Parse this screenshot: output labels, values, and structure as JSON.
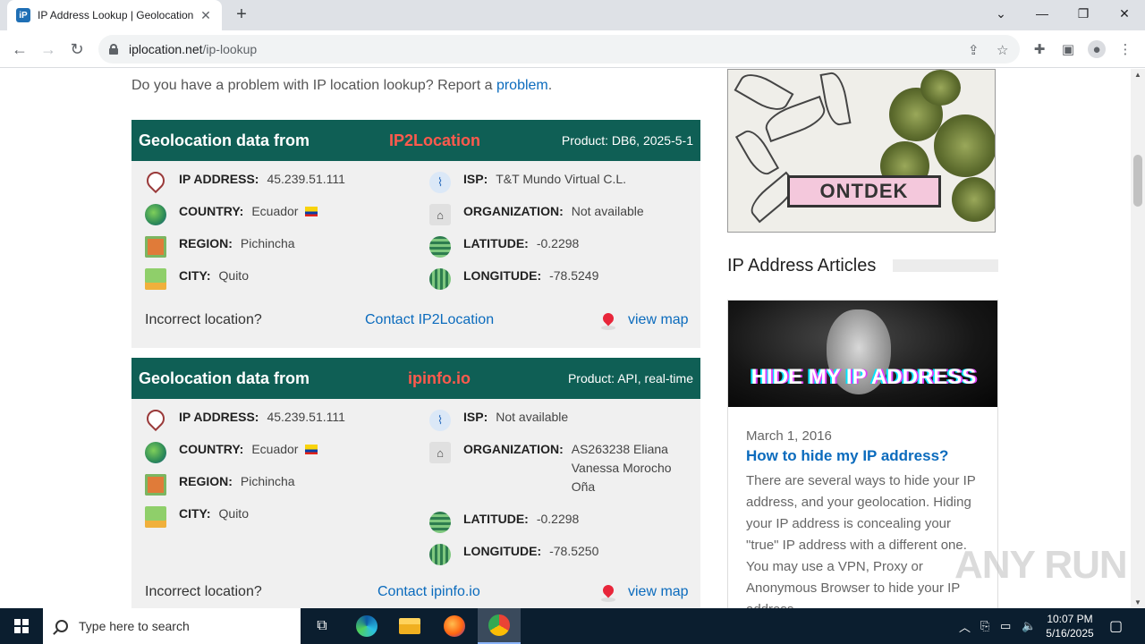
{
  "browser": {
    "tab_title": "IP Address Lookup | Geolocation",
    "favicon": "iP",
    "url_domain": "iplocation.net",
    "url_path": "/ip-lookup"
  },
  "page": {
    "report_text": "Do you have a problem with IP location lookup? Report a ",
    "report_link": "problem",
    "report_end": "."
  },
  "panels": [
    {
      "label": "Geolocation data from",
      "provider": "IP2Location",
      "product": "Product: DB6, 2025-5-1",
      "left_rows": [
        {
          "key": "IP ADDRESS:",
          "value": "45.239.51.111",
          "icon": "pin-icon"
        },
        {
          "key": "COUNTRY:",
          "value": "Ecuador",
          "icon": "globe-icon"
        },
        {
          "key": "REGION:",
          "value": "Pichincha",
          "icon": "region-map-icon"
        },
        {
          "key": "CITY:",
          "value": "Quito",
          "icon": "city-icon"
        }
      ],
      "right_rows": [
        {
          "key": "ISP:",
          "value": "T&T Mundo Virtual C.L.",
          "icon": "antenna-icon"
        },
        {
          "key": "ORGANIZATION:",
          "value": "Not available",
          "icon": "building-icon"
        },
        {
          "key": "LATITUDE:",
          "value": "-0.2298",
          "icon": "latitude-icon"
        },
        {
          "key": "LONGITUDE:",
          "value": "-78.5249",
          "icon": "longitude-icon"
        }
      ],
      "incorrect": "Incorrect location?",
      "contact": "Contact IP2Location",
      "view_map": "view map"
    },
    {
      "label": "Geolocation data from",
      "provider": "ipinfo.io",
      "product": "Product: API, real-time",
      "left_rows": [
        {
          "key": "IP ADDRESS:",
          "value": "45.239.51.111",
          "icon": "pin-icon"
        },
        {
          "key": "COUNTRY:",
          "value": "Ecuador",
          "icon": "globe-icon"
        },
        {
          "key": "REGION:",
          "value": "Pichincha",
          "icon": "region-map-icon"
        },
        {
          "key": "CITY:",
          "value": "Quito",
          "icon": "city-icon"
        }
      ],
      "right_rows": [
        {
          "key": "ISP:",
          "value": "Not available",
          "icon": "antenna-icon"
        },
        {
          "key": "ORGANIZATION:",
          "value": "AS263238 Eliana Vanessa Morocho Oña",
          "icon": "building-icon"
        },
        {
          "key": "LATITUDE:",
          "value": "-0.2298",
          "icon": "latitude-icon"
        },
        {
          "key": "LONGITUDE:",
          "value": "-78.5250",
          "icon": "longitude-icon"
        }
      ],
      "incorrect": "Incorrect location?",
      "contact": "Contact ipinfo.io",
      "view_map": "view map"
    }
  ],
  "sidebar": {
    "ad_label": "ONTDEK",
    "articles_title": "IP Address Articles",
    "article": {
      "image_text": "HIDE MY IP ADDRESS",
      "date": "March 1, 2016",
      "title": "How to hide my IP address?",
      "body": "There are several ways to hide your IP address, and your geolocation. Hiding your IP address is concealing your \"true\" IP address with a different one. You may use a VPN, Proxy or Anonymous Browser to hide your IP address."
    }
  },
  "watermark": "ANY RUN",
  "taskbar": {
    "search_placeholder": "Type here to search",
    "time": "10:07 PM",
    "date": "5/16/2025"
  }
}
